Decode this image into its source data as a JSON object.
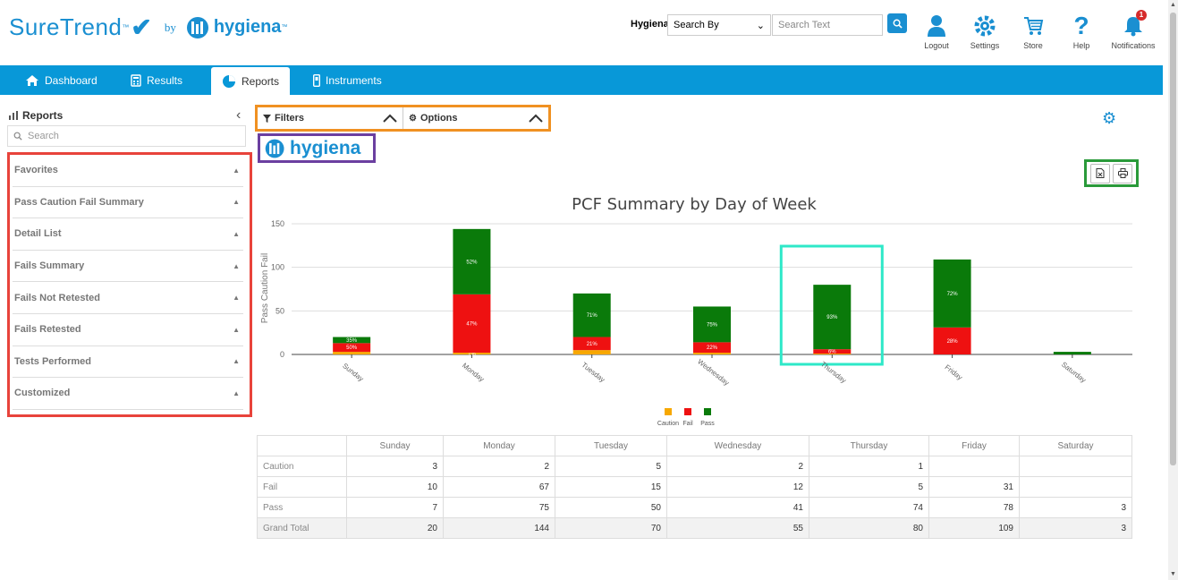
{
  "header": {
    "brand": "SureTrend",
    "brand_tm": "™",
    "by": "by",
    "partner": "hygiena",
    "partner_tm": "™",
    "org": "Hygiena",
    "search_by": "Search By",
    "search_placeholder": "Search Text",
    "buttons": [
      {
        "label": "Logout",
        "icon": "user-icon"
      },
      {
        "label": "Settings",
        "icon": "gear-icon"
      },
      {
        "label": "Store",
        "icon": "cart-icon"
      },
      {
        "label": "Help",
        "icon": "question-icon"
      },
      {
        "label": "Notifications",
        "icon": "bell-icon"
      }
    ],
    "notification_count": "1"
  },
  "nav": {
    "tabs": [
      {
        "label": "Dashboard",
        "icon": "home-icon"
      },
      {
        "label": "Results",
        "icon": "calculator-icon"
      },
      {
        "label": "Reports",
        "icon": "pie-icon"
      },
      {
        "label": "Instruments",
        "icon": "device-icon"
      }
    ],
    "active": "Reports"
  },
  "sidebar": {
    "title": "Reports",
    "search_placeholder": "Search",
    "items": [
      {
        "label": "Favorites"
      },
      {
        "label": "Pass Caution Fail Summary"
      },
      {
        "label": "Detail List"
      },
      {
        "label": "Fails Summary"
      },
      {
        "label": "Fails Not Retested"
      },
      {
        "label": "Fails Retested"
      },
      {
        "label": "Tests Performed"
      },
      {
        "label": "Customized"
      }
    ]
  },
  "toolbar": {
    "filters_label": "Filters",
    "options_label": "Options"
  },
  "report_logo": "hygiena",
  "colors": {
    "accent": "#0898d8",
    "pass": "#0a7a0a",
    "fail": "#ee1111",
    "caution": "#f7a800"
  },
  "chart_data": {
    "type": "bar",
    "stacked": true,
    "title": "PCF Summary by Day of Week",
    "ylabel": "Pass Caution Fail",
    "ylim": [
      0,
      150
    ],
    "yticks": [
      0,
      50,
      100,
      150
    ],
    "categories": [
      "Sunday",
      "Monday",
      "Tuesday",
      "Wednesday",
      "Thursday",
      "Friday",
      "Saturday"
    ],
    "series": [
      {
        "name": "Caution",
        "color": "#f7a800",
        "values": [
          3,
          2,
          5,
          2,
          1,
          0,
          0
        ]
      },
      {
        "name": "Fail",
        "color": "#ee1111",
        "values": [
          10,
          67,
          15,
          12,
          5,
          31,
          0
        ]
      },
      {
        "name": "Pass",
        "color": "#0a7a0a",
        "values": [
          7,
          75,
          50,
          41,
          74,
          78,
          3
        ]
      }
    ],
    "data_labels": {
      "Caution": [
        "",
        "1%",
        "",
        "",
        "",
        "",
        ""
      ],
      "Fail": [
        "50%",
        "47%",
        "21%",
        "22%",
        "6%",
        "28%",
        ""
      ],
      "Pass": [
        "35%",
        "52%",
        "71%",
        "75%",
        "93%",
        "72%",
        ""
      ]
    },
    "legend": "bottom-center"
  },
  "table": {
    "columns": [
      "",
      "Sunday",
      "Monday",
      "Tuesday",
      "Wednesday",
      "Thursday",
      "Friday",
      "Saturday"
    ],
    "rows": [
      {
        "label": "Caution",
        "values": [
          "3",
          "2",
          "5",
          "2",
          "1",
          "",
          ""
        ]
      },
      {
        "label": "Fail",
        "values": [
          "10",
          "67",
          "15",
          "12",
          "5",
          "31",
          ""
        ]
      },
      {
        "label": "Pass",
        "values": [
          "7",
          "75",
          "50",
          "41",
          "74",
          "78",
          "3"
        ]
      },
      {
        "label": "Grand Total",
        "values": [
          "20",
          "144",
          "70",
          "55",
          "80",
          "109",
          "3"
        ]
      }
    ]
  }
}
